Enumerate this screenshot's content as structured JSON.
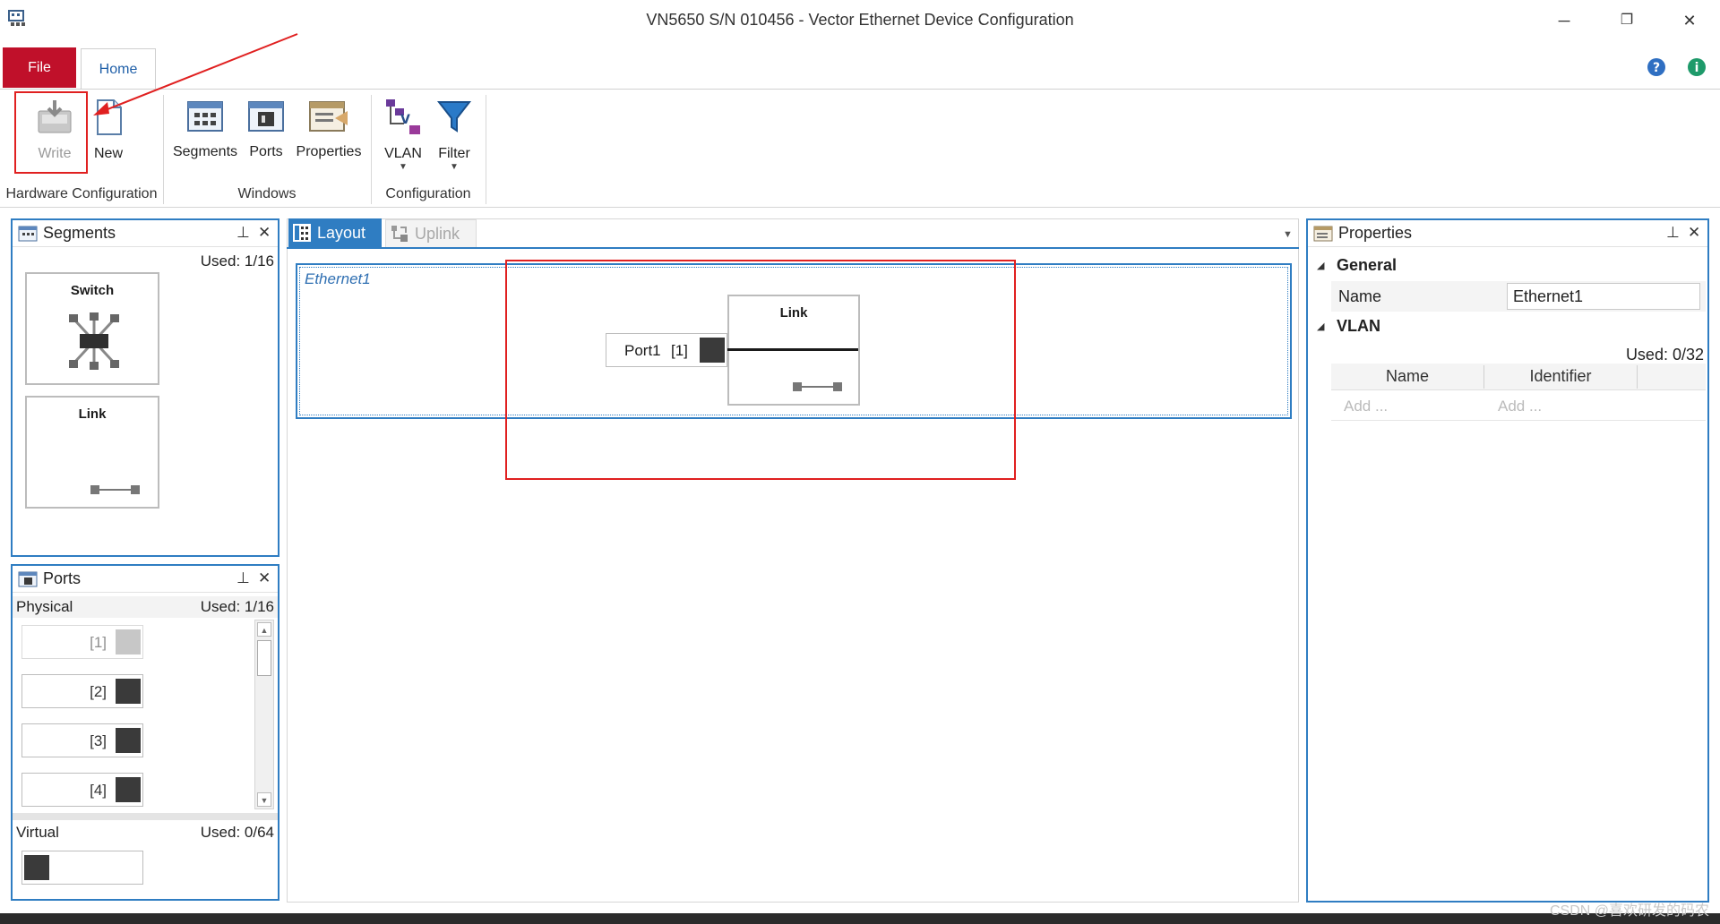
{
  "window": {
    "title": "VN5650 S/N 010456 - Vector Ethernet Device Configuration",
    "minimize_icon": "─",
    "restore_icon": "❐",
    "close_icon": "✕"
  },
  "ribbon": {
    "tabs": {
      "file": "File",
      "home": "Home"
    },
    "hardware": {
      "write": "Write",
      "new": "New",
      "group": "Hardware Configuration"
    },
    "windows": {
      "segments": "Segments",
      "ports": "Ports",
      "properties": "Properties",
      "group": "Windows"
    },
    "configuration": {
      "vlan": "VLAN",
      "filter": "Filter",
      "group": "Configuration"
    }
  },
  "segments_panel": {
    "title": "Segments",
    "used": "Used: 1/16",
    "cards": [
      {
        "label": "Switch"
      },
      {
        "label": "Link"
      }
    ]
  },
  "ports_panel": {
    "title": "Ports",
    "physical_label": "Physical",
    "physical_used": "Used: 1/16",
    "ports": [
      {
        "num": "[1]"
      },
      {
        "num": "[2]"
      },
      {
        "num": "[3]"
      },
      {
        "num": "[4]"
      }
    ],
    "virtual_label": "Virtual",
    "virtual_used": "Used: 0/64"
  },
  "center": {
    "tabs": {
      "layout": "Layout",
      "uplink": "Uplink"
    },
    "segment_name": "Ethernet1",
    "port_label": "Port1",
    "port_num": "[1]",
    "link_label": "Link"
  },
  "properties_panel": {
    "title": "Properties",
    "general": "General",
    "name_label": "Name",
    "name_value": "Ethernet1",
    "vlan": "VLAN",
    "vlan_used": "Used: 0/32",
    "col_name": "Name",
    "col_identifier": "Identifier",
    "add_name": "Add ...",
    "add_identifier": "Add ..."
  },
  "watermark": "CSDN @喜欢研发的码农",
  "colors": {
    "accent": "#2f7dc2",
    "file_tab": "#c0102a",
    "annotation": "#e02020"
  }
}
